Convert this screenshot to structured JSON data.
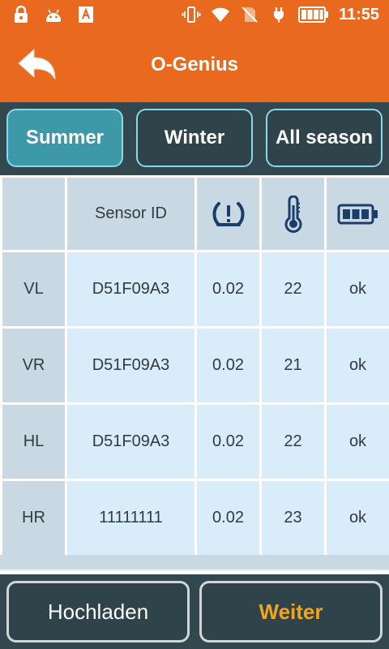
{
  "status_bar": {
    "time": "11:55",
    "left_icons": [
      "lock-icon",
      "android-icon",
      "font-a-icon"
    ],
    "right_icons": [
      "vibrate-icon",
      "wifi-icon",
      "no-sim-icon",
      "charging-plug-icon",
      "battery-icon"
    ]
  },
  "header": {
    "title": "O-Genius",
    "back_icon": "back-arrow-icon",
    "color": "#e96a1e"
  },
  "tabs": [
    {
      "label": "Summer",
      "active": true
    },
    {
      "label": "Winter",
      "active": false
    },
    {
      "label": "All season",
      "active": false
    }
  ],
  "table": {
    "columns": [
      {
        "label": ""
      },
      {
        "label": "Sensor ID"
      },
      {
        "icon": "tire-pressure-icon"
      },
      {
        "icon": "thermometer-icon"
      },
      {
        "icon": "battery-icon"
      }
    ],
    "rows": [
      {
        "position": "VL",
        "sensor_id": "D51F09A3",
        "pressure": "0.02",
        "temperature": "22",
        "battery": "ok"
      },
      {
        "position": "VR",
        "sensor_id": "D51F09A3",
        "pressure": "0.02",
        "temperature": "21",
        "battery": "ok"
      },
      {
        "position": "HL",
        "sensor_id": "D51F09A3",
        "pressure": "0.02",
        "temperature": "22",
        "battery": "ok"
      },
      {
        "position": "HR",
        "sensor_id": "11111111",
        "pressure": "0.02",
        "temperature": "23",
        "battery": "ok"
      }
    ]
  },
  "buttons": {
    "upload_label": "Hochladen",
    "next_label": "Weiter",
    "next_color": "#f2a51c"
  },
  "colors": {
    "accent_orange": "#e96a1e",
    "dark_bar": "#33474f",
    "active_tab": "#3d99a8",
    "icon_blue": "#1a3d6b"
  }
}
